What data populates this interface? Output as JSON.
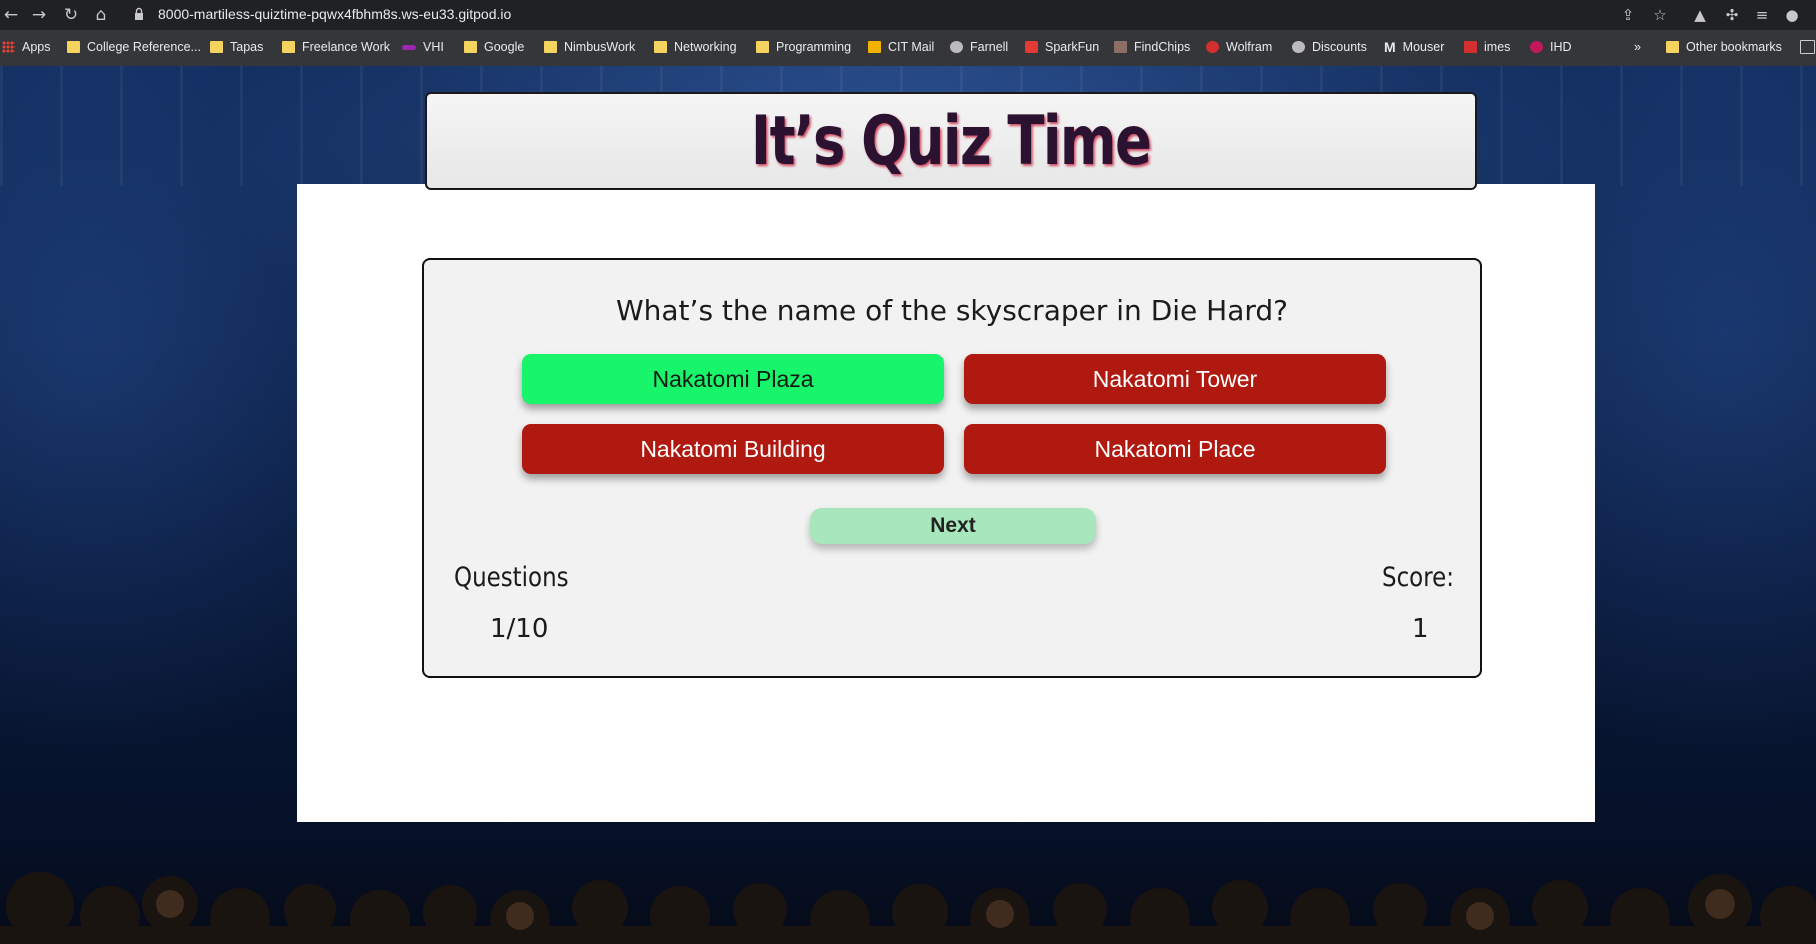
{
  "browser": {
    "url": "8000-martiless-quiztime-pqwx4fbhm8s.ws-eu33.gitpod.io",
    "bookmarks": [
      {
        "label": "Apps",
        "icon": "apps-grid-icon"
      },
      {
        "label": "College Reference...",
        "icon": "folder-icon"
      },
      {
        "label": "Tapas",
        "icon": "folder-icon"
      },
      {
        "label": "Freelance Work",
        "icon": "folder-icon"
      },
      {
        "label": "VHI",
        "icon": "vhi-icon"
      },
      {
        "label": "Google",
        "icon": "folder-icon"
      },
      {
        "label": "NimbusWork",
        "icon": "folder-icon"
      },
      {
        "label": "Networking",
        "icon": "folder-icon"
      },
      {
        "label": "Programming",
        "icon": "folder-icon"
      },
      {
        "label": "CIT Mail",
        "icon": "mail-icon"
      },
      {
        "label": "Farnell",
        "icon": "farnell-icon"
      },
      {
        "label": "SparkFun",
        "icon": "sparkfun-icon"
      },
      {
        "label": "FindChips",
        "icon": "findchips-icon"
      },
      {
        "label": "Wolfram",
        "icon": "wolfram-icon"
      },
      {
        "label": "Discounts",
        "icon": "globe-icon"
      },
      {
        "label": "Mouser",
        "icon": "mouser-icon"
      },
      {
        "label": "imes",
        "icon": "imes-icon"
      },
      {
        "label": "IHD",
        "icon": "ihd-icon"
      }
    ],
    "overflow_label": "»",
    "other_bookmarks": "Other bookmarks"
  },
  "quiz": {
    "title": "It’s Quiz Time",
    "question": "What’s the name of the skyscraper in Die Hard?",
    "answers": [
      {
        "label": "Nakatomi Plaza",
        "state": "correct"
      },
      {
        "label": "Nakatomi Tower",
        "state": "wrong"
      },
      {
        "label": "Nakatomi Building",
        "state": "wrong"
      },
      {
        "label": "Nakatomi Place",
        "state": "wrong"
      }
    ],
    "next_label": "Next",
    "questions_label": "Questions",
    "questions_value": "1/10",
    "score_label": "Score:",
    "score_value": "1"
  },
  "colors": {
    "correct": "#18f56a",
    "wrong": "#b0190f",
    "next": "#a8e6bb"
  }
}
